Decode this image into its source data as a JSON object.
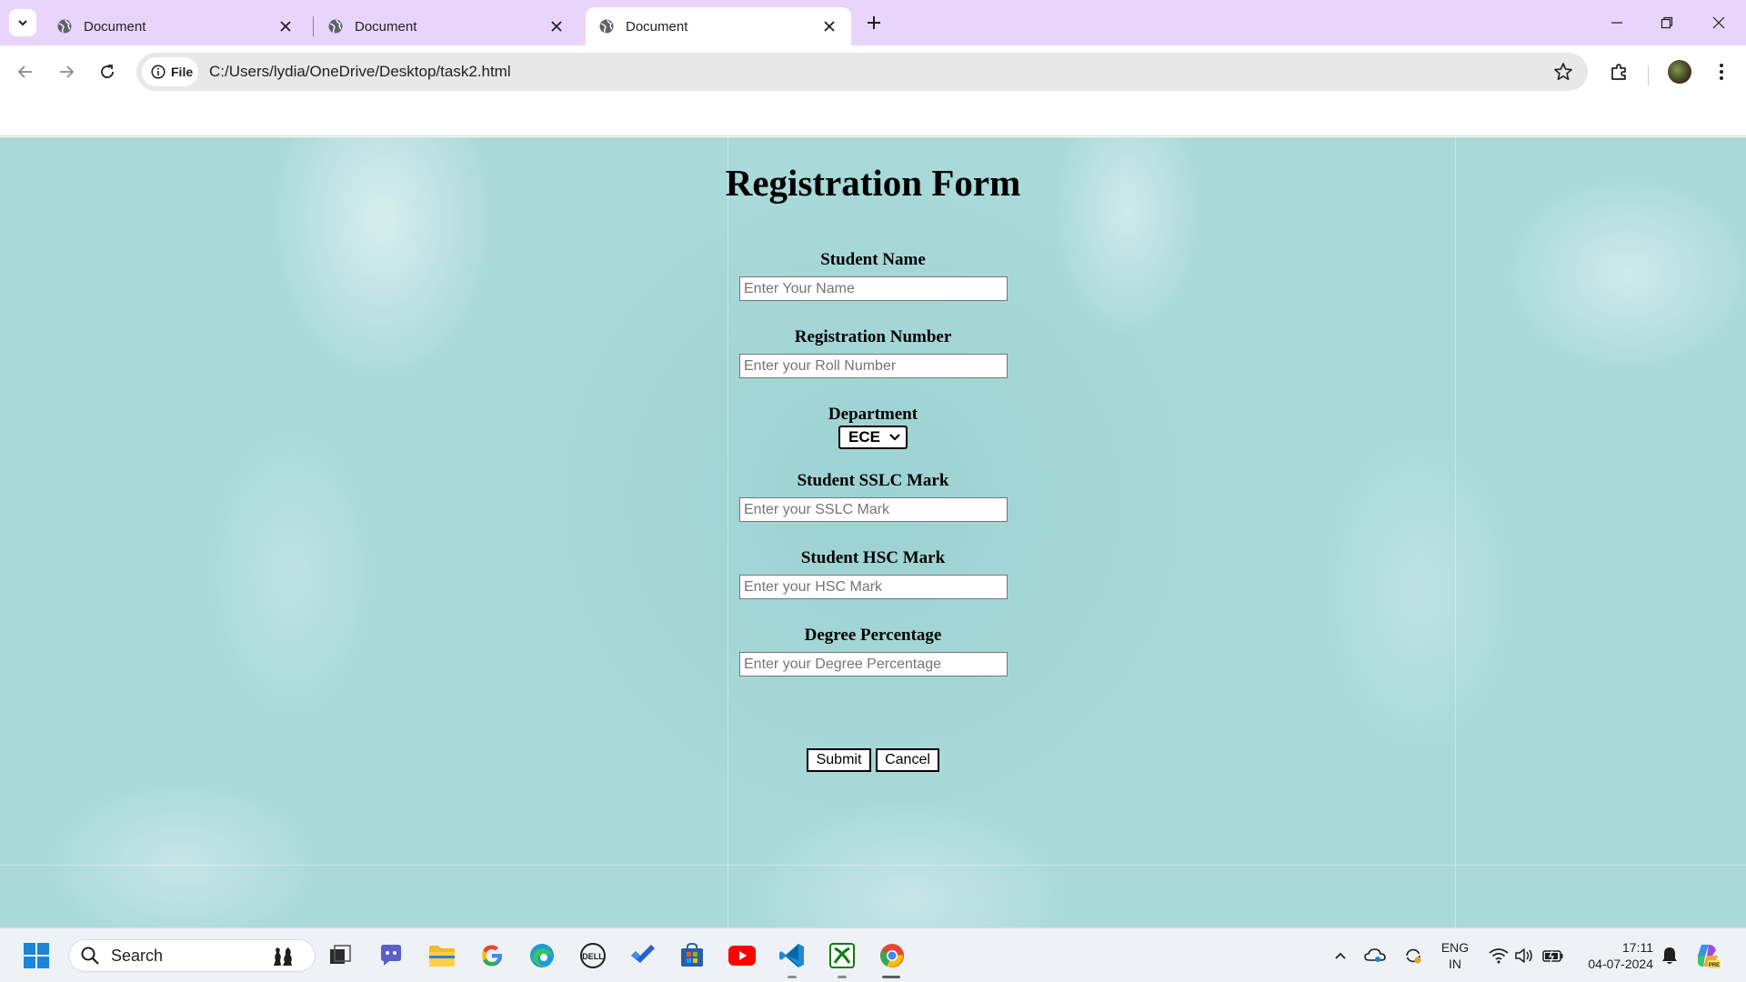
{
  "browser": {
    "tabs": [
      {
        "title": "Document",
        "active": false
      },
      {
        "title": "Document",
        "active": false
      },
      {
        "title": "Document",
        "active": true
      }
    ],
    "site_chip": "File",
    "url": "C:/Users/lydia/OneDrive/Desktop/task2.html"
  },
  "form": {
    "title": "Registration Form",
    "fields": [
      {
        "label": "Student Name",
        "placeholder": "Enter Your Name",
        "value": ""
      },
      {
        "label": "Registration Number",
        "placeholder": "Enter your Roll Number",
        "value": ""
      },
      {
        "label": "Student SSLC Mark",
        "placeholder": "Enter your SSLC Mark",
        "value": ""
      },
      {
        "label": "Student HSC Mark",
        "placeholder": "Enter your HSC Mark",
        "value": ""
      },
      {
        "label": "Degree Percentage",
        "placeholder": "Enter your Degree Percentage",
        "value": ""
      }
    ],
    "department": {
      "label": "Department",
      "selected": "ECE"
    },
    "submit_label": "Submit",
    "cancel_label": "Cancel"
  },
  "taskbar": {
    "search_label": "Search",
    "apps": [
      "windows-start-icon",
      "chess-icon",
      "task-view-icon",
      "teams-icon",
      "file-explorer-icon",
      "google-icon",
      "edge-icon",
      "dell-icon",
      "todo-icon",
      "store-icon",
      "youtube-icon",
      "vscode-icon",
      "xbox-icon",
      "chrome-icon"
    ],
    "language_line1": "ENG",
    "language_line2": "IN",
    "time": "17:11",
    "date": "04-07-2024"
  },
  "colors": {
    "tabstrip": "#e9d5fb",
    "page_background": "#a9d9d9",
    "taskbar": "#eef1f5"
  }
}
